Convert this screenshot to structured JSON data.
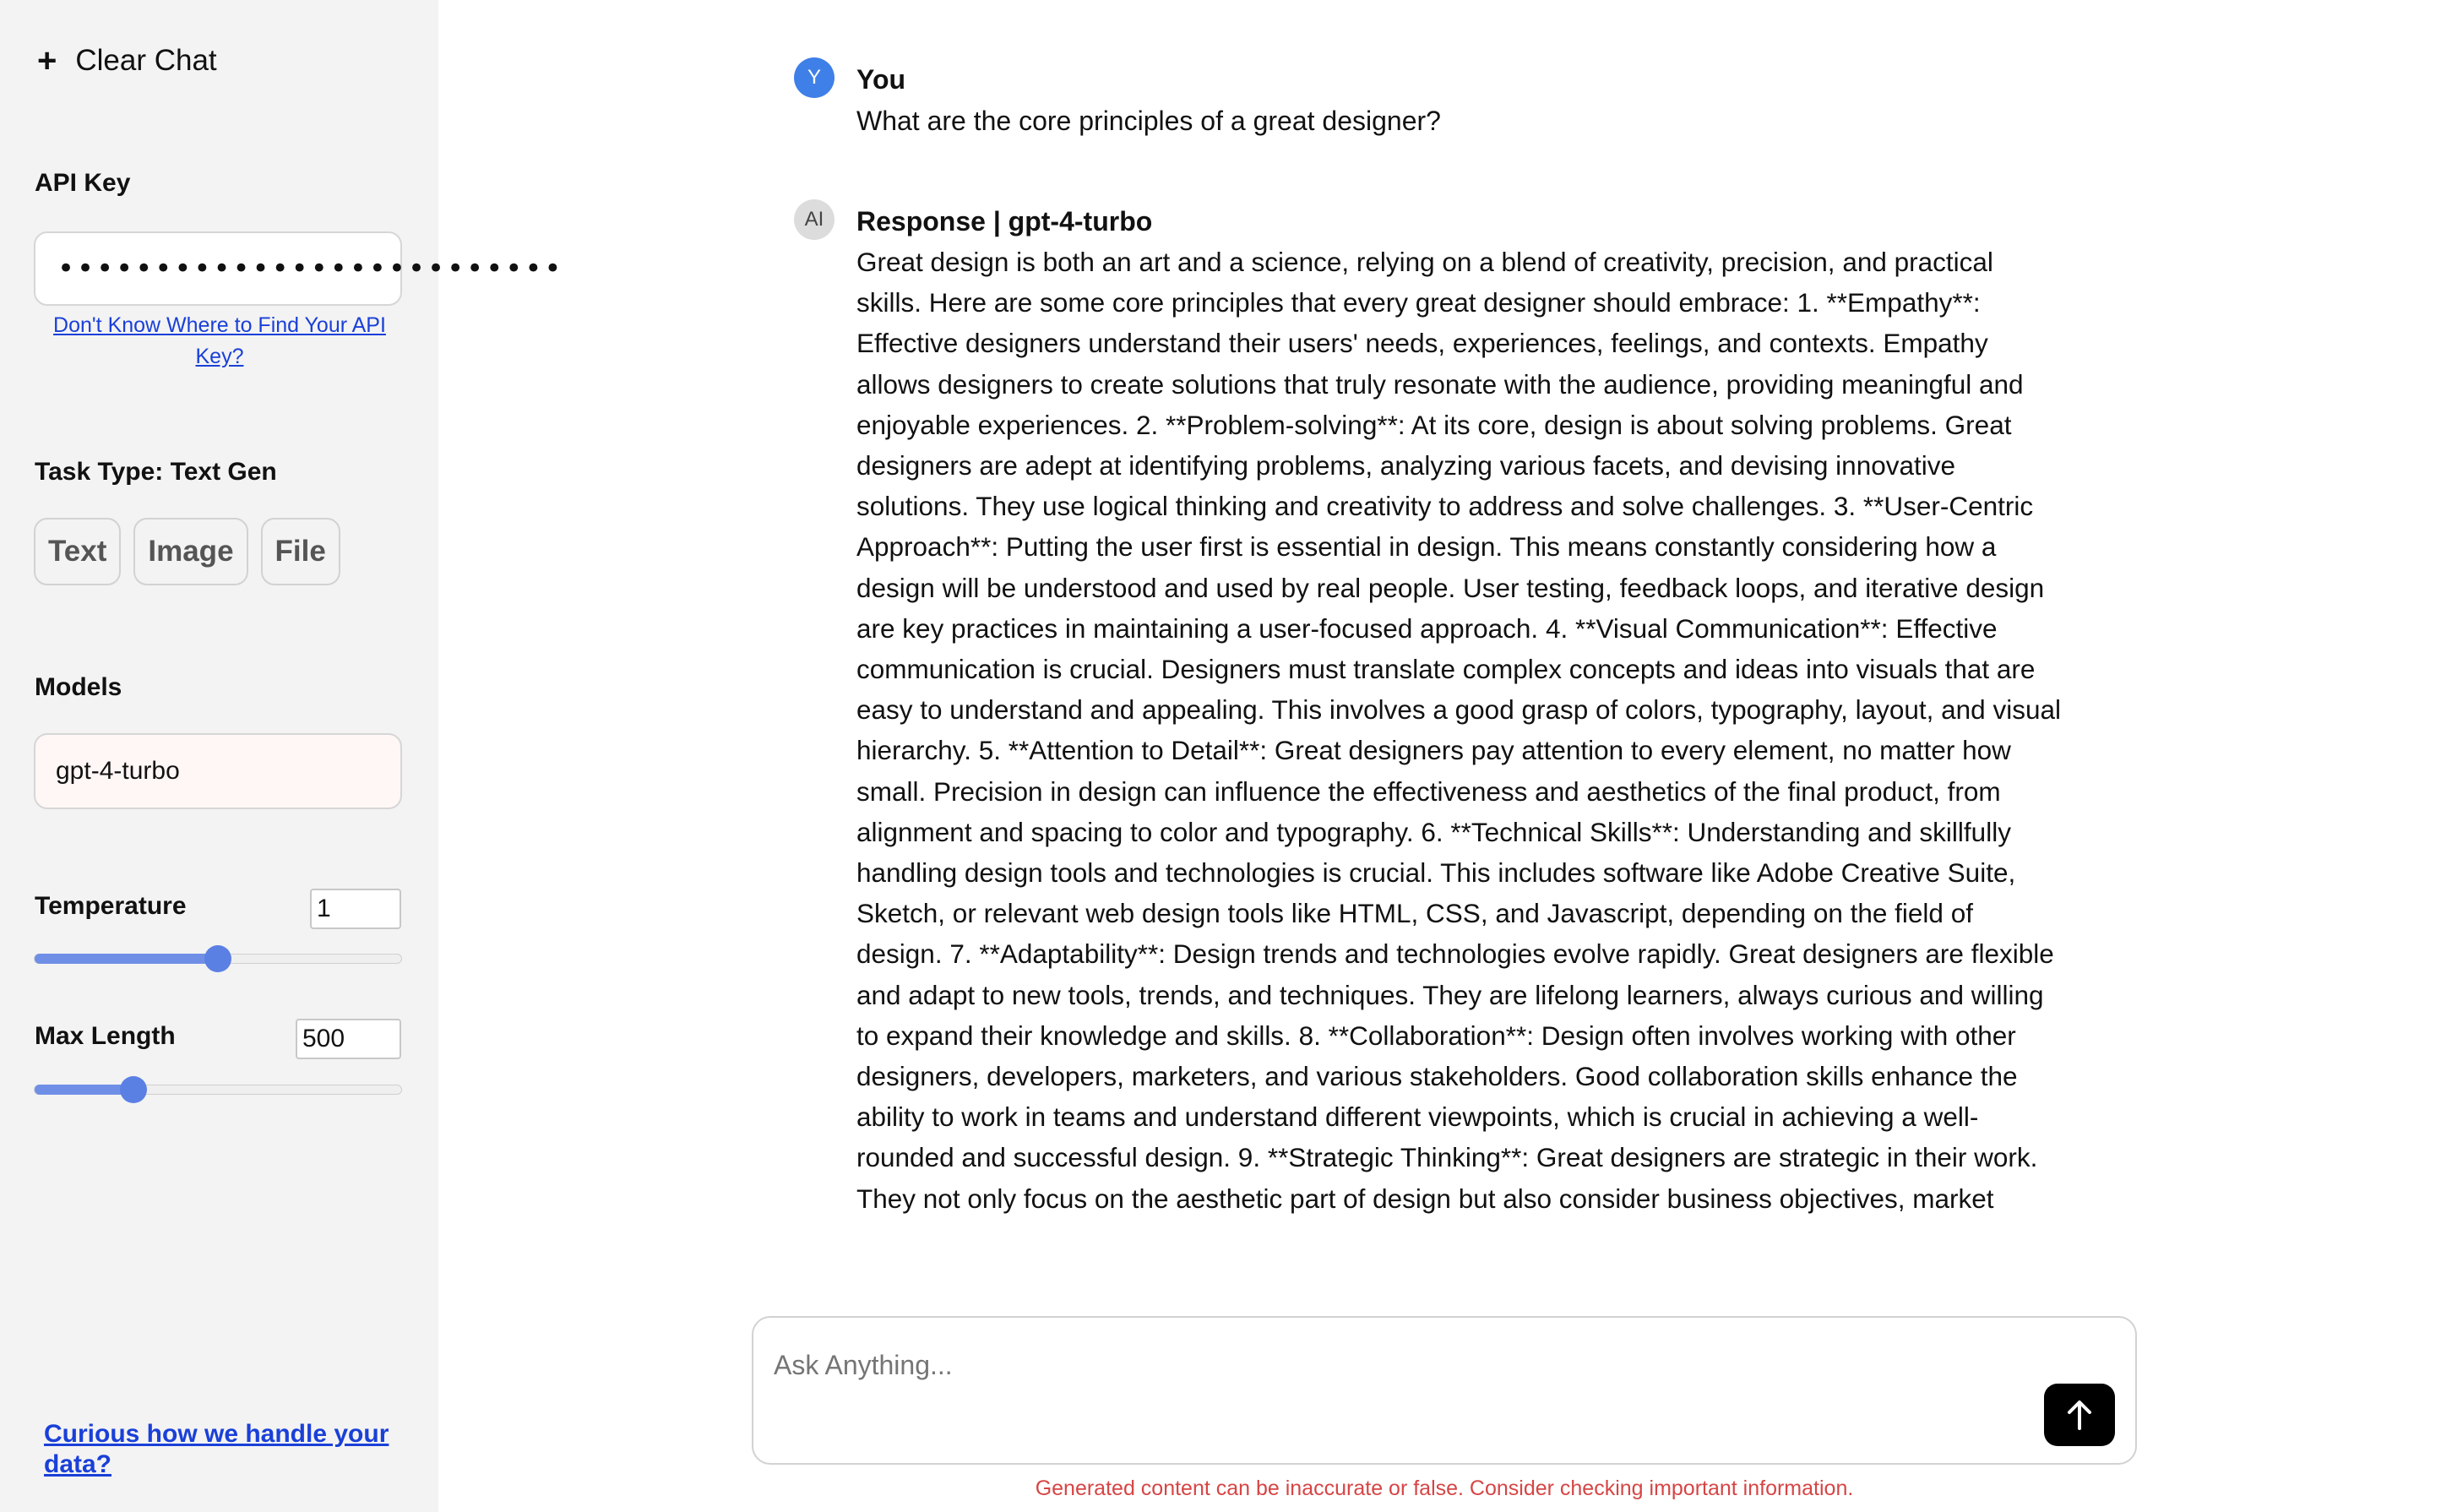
{
  "sidebar": {
    "clear_chat_icon": "+",
    "clear_chat_label": "Clear Chat",
    "api_key_label": "API Key",
    "api_key_value": "••••••••••••••••••••••••••",
    "api_key_help_link": "Don't Know Where to Find Your API Key?",
    "task_type_label": "Task Type: Text Gen",
    "task_buttons": [
      "Text",
      "Image",
      "File"
    ],
    "models_label": "Models",
    "model_value": "gpt-4-turbo",
    "temperature_label": "Temperature",
    "temperature_value": "1",
    "temperature_fraction": 0.5,
    "max_length_label": "Max Length",
    "max_length_value": "500",
    "max_length_fraction": 0.27,
    "privacy_link": "Curious how we handle your data?"
  },
  "chat": {
    "user_avatar": "Y",
    "user_name": "You",
    "user_message": "What are the core principles of a great designer?",
    "ai_avatar": "AI",
    "ai_name": "Response | gpt-4-turbo",
    "ai_message": "Great design is both an art and a science, relying on a blend of creativity, precision, and practical skills. Here are some core principles that every great designer should embrace: 1. **Empathy**: Effective designers understand their users' needs, experiences, feelings, and contexts. Empathy allows designers to create solutions that truly resonate with the audience, providing meaningful and enjoyable experiences. 2. **Problem-solving**: At its core, design is about solving problems. Great designers are adept at identifying problems, analyzing various facets, and devising innovative solutions. They use logical thinking and creativity to address and solve challenges. 3. **User-Centric Approach**: Putting the user first is essential in design. This means constantly considering how a design will be understood and used by real people. User testing, feedback loops, and iterative design are key practices in maintaining a user-focused approach. 4. **Visual Communication**: Effective communication is crucial. Designers must translate complex concepts and ideas into visuals that are easy to understand and appealing. This involves a good grasp of colors, typography, layout, and visual hierarchy. 5. **Attention to Detail**: Great designers pay attention to every element, no matter how small. Precision in design can influence the effectiveness and aesthetics of the final product, from alignment and spacing to color and typography. 6. **Technical Skills**: Understanding and skillfully handling design tools and technologies is crucial. This includes software like Adobe Creative Suite, Sketch, or relevant web design tools like HTML, CSS, and Javascript, depending on the field of design. 7. **Adaptability**: Design trends and technologies evolve rapidly. Great designers are flexible and adapt to new tools, trends, and techniques. They are lifelong learners, always curious and willing to expand their knowledge and skills. 8. **Collaboration**: Design often involves working with other designers, developers, marketers, and various stakeholders. Good collaboration skills enhance the ability to work in teams and understand different viewpoints, which is crucial in achieving a well-rounded and successful design. 9. **Strategic Thinking**: Great designers are strategic in their work. They not only focus on the aesthetic part of design but also consider business objectives, market"
  },
  "composer": {
    "placeholder": "Ask Anything...",
    "send_icon": "arrow-up-icon",
    "disclaimer": "Generated content can be inaccurate or false. Consider checking important information."
  },
  "colors": {
    "accent": "#5b80e4",
    "link": "#1a40d8",
    "warning": "#d64545",
    "sidebar_bg": "#f3f3f3"
  }
}
